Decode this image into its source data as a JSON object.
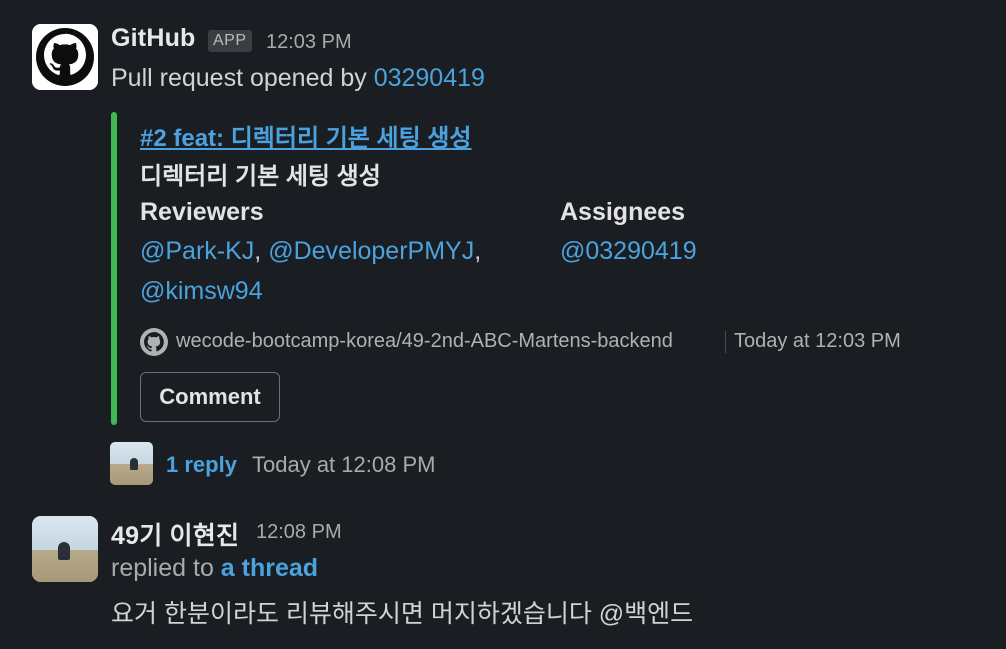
{
  "message1": {
    "sender": "GitHub",
    "badge": "APP",
    "time": "12:03 PM",
    "text_prefix": "Pull request opened by ",
    "author_link": "03290419",
    "attachment": {
      "title": "#2 feat: 디렉터리 기본 세팅 생성",
      "subtitle": "디렉터리 기본 세팅 생성",
      "reviewers_label": "Reviewers",
      "reviewers": [
        "@Park-KJ",
        "@DeveloperPMYJ",
        "@kimsw94"
      ],
      "separator": ",",
      "assignees_label": "Assignees",
      "assignees": [
        "@03290419"
      ],
      "repo": "wecode-bootcamp-korea/49-2nd-ABC-Martens-backend",
      "footer_time": "Today at 12:03 PM",
      "comment_label": "Comment",
      "accent_color": "#3fb950"
    },
    "thread": {
      "reply_count": "1 reply",
      "reply_time": "Today at 12:08 PM"
    }
  },
  "message2": {
    "sender": "49기 이현진",
    "time": "12:08 PM",
    "replied_prefix": "replied to ",
    "thread_link": "a thread",
    "text": "요거 한분이라도 리뷰해주시면 머지하겠습니다 @백엔드"
  },
  "icons": {
    "app_avatar": "github-logo-icon",
    "repo_icon": "github-logo-icon"
  }
}
